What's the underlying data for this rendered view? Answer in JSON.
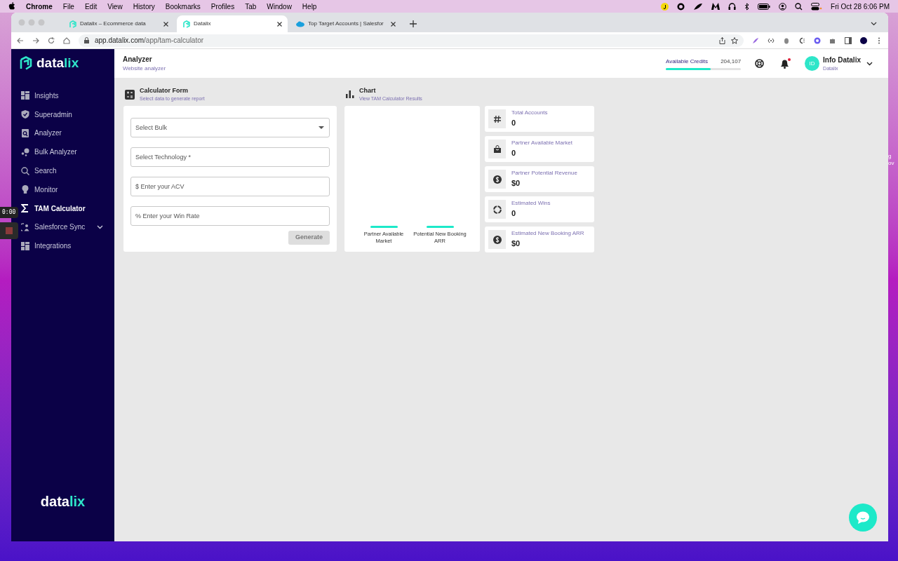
{
  "menu_bar": {
    "app": "Chrome",
    "items": [
      "File",
      "Edit",
      "View",
      "History",
      "Bookmarks",
      "Profiles",
      "Tab",
      "Window",
      "Help"
    ],
    "clock": "Fri Oct 28  6:06 PM"
  },
  "browser": {
    "tabs": [
      {
        "title": "Datalix – Ecommerce data",
        "selected": false,
        "kind": "datalix"
      },
      {
        "title": "Datalix",
        "selected": true,
        "kind": "datalix"
      },
      {
        "title": "Top Target Accounts | Salesfor",
        "selected": false,
        "kind": "cloud"
      }
    ],
    "url_host": "app.datalix.com",
    "url_path": "/app/tam-calculator"
  },
  "sidebar": {
    "logo_a": "data",
    "logo_b": "lix",
    "items": [
      {
        "label": "Insights",
        "selected": false,
        "expandable": false
      },
      {
        "label": "Superadmin",
        "selected": false,
        "expandable": false
      },
      {
        "label": "Analyzer",
        "selected": false,
        "expandable": false
      },
      {
        "label": "Bulk Analyzer",
        "selected": false,
        "expandable": false
      },
      {
        "label": "Search",
        "selected": false,
        "expandable": false
      },
      {
        "label": "Monitor",
        "selected": false,
        "expandable": false
      },
      {
        "label": "TAM Calculator",
        "selected": true,
        "expandable": false
      },
      {
        "label": "Salesforce Sync",
        "selected": false,
        "expandable": true
      },
      {
        "label": "Integrations",
        "selected": false,
        "expandable": false
      }
    ],
    "footer_logo_a": "data",
    "footer_logo_b": "lix"
  },
  "header": {
    "title": "Analyzer",
    "subtitle": "Website analyzer",
    "credits_label": "Available Credits",
    "credits_value": "204,107",
    "level": 0.6,
    "notification": true,
    "avatar": "ID",
    "user_name": "Info Datalix",
    "user_org": "Datalix"
  },
  "form": {
    "title": "Calculator Form",
    "subtitle": "Select data to generate report",
    "fields": [
      {
        "placeholder": "Select Bulk",
        "kind": "select"
      },
      {
        "placeholder": "Select Technology *",
        "kind": "text"
      },
      {
        "placeholder": "$ Enter your ACV",
        "kind": "text"
      },
      {
        "placeholder": "% Enter your Win Rate",
        "kind": "text"
      }
    ],
    "button": {
      "label": "Generate",
      "disabled": true
    }
  },
  "chart": {
    "title": "Chart",
    "subtitle": "View TAM Calculator Results",
    "category_labels": [
      "Partner Available Market",
      "Potential New Booking ARR"
    ]
  },
  "stats": [
    {
      "label": "Total Accounts",
      "value": "0"
    },
    {
      "label": "Partner Available Market",
      "value": "0"
    },
    {
      "label": "Partner Potential Revenue",
      "value": "$0"
    },
    {
      "label": "Estimated Wins",
      "value": "0"
    },
    {
      "label": "Estimated New Booking ARR",
      "value": "$0"
    }
  ],
  "recorder": {
    "time": "0:00"
  },
  "desktop_labels": [
    "g",
    "ov"
  ]
}
